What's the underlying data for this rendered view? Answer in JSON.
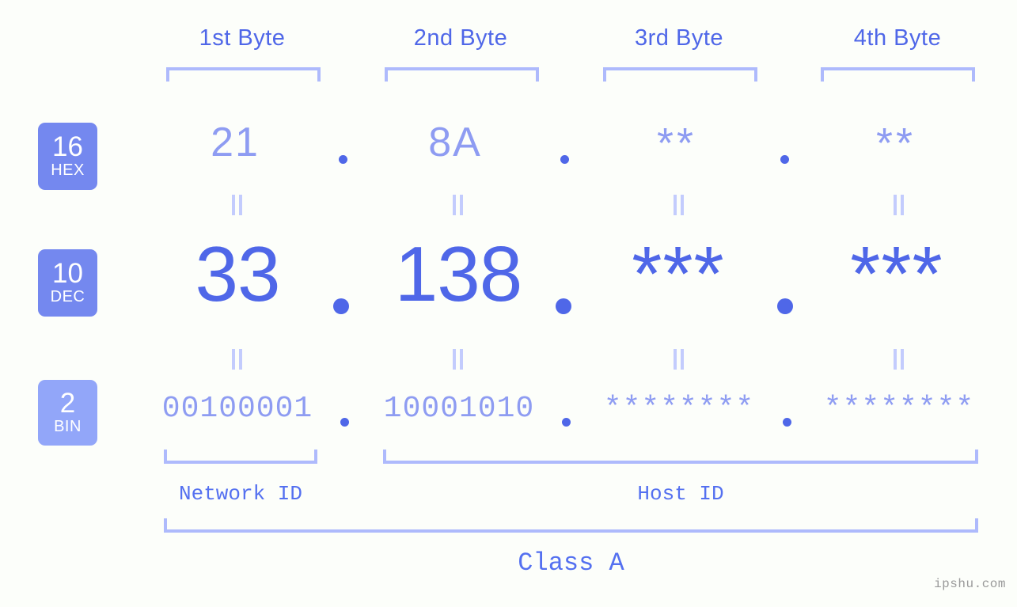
{
  "meta": {
    "watermark": "ipshu.com",
    "background_color": "#fcfefa",
    "accent_strong": "#4f67e8",
    "accent_light": "#8e9cf2",
    "accent_bracket": "#aebafc",
    "badge_color": "#7488ef",
    "badge_color_bin": "#92a6f9"
  },
  "columns": [
    {
      "label": "1st Byte"
    },
    {
      "label": "2nd Byte"
    },
    {
      "label": "3rd Byte"
    },
    {
      "label": "4th Byte"
    }
  ],
  "rows": {
    "hex": {
      "badge_number": "16",
      "badge_abbr": "HEX",
      "values": [
        "21",
        "8A",
        "**",
        "**"
      ],
      "separator": "."
    },
    "dec": {
      "badge_number": "10",
      "badge_abbr": "DEC",
      "values": [
        "33",
        "138",
        "***",
        "***"
      ],
      "separator": "."
    },
    "bin": {
      "badge_number": "2",
      "badge_abbr": "BIN",
      "values": [
        "00100001",
        "10001010",
        "********",
        "********"
      ],
      "separator": "."
    }
  },
  "segments": {
    "network_id": "Network ID",
    "host_id": "Host ID"
  },
  "class": {
    "label": "Class A"
  }
}
